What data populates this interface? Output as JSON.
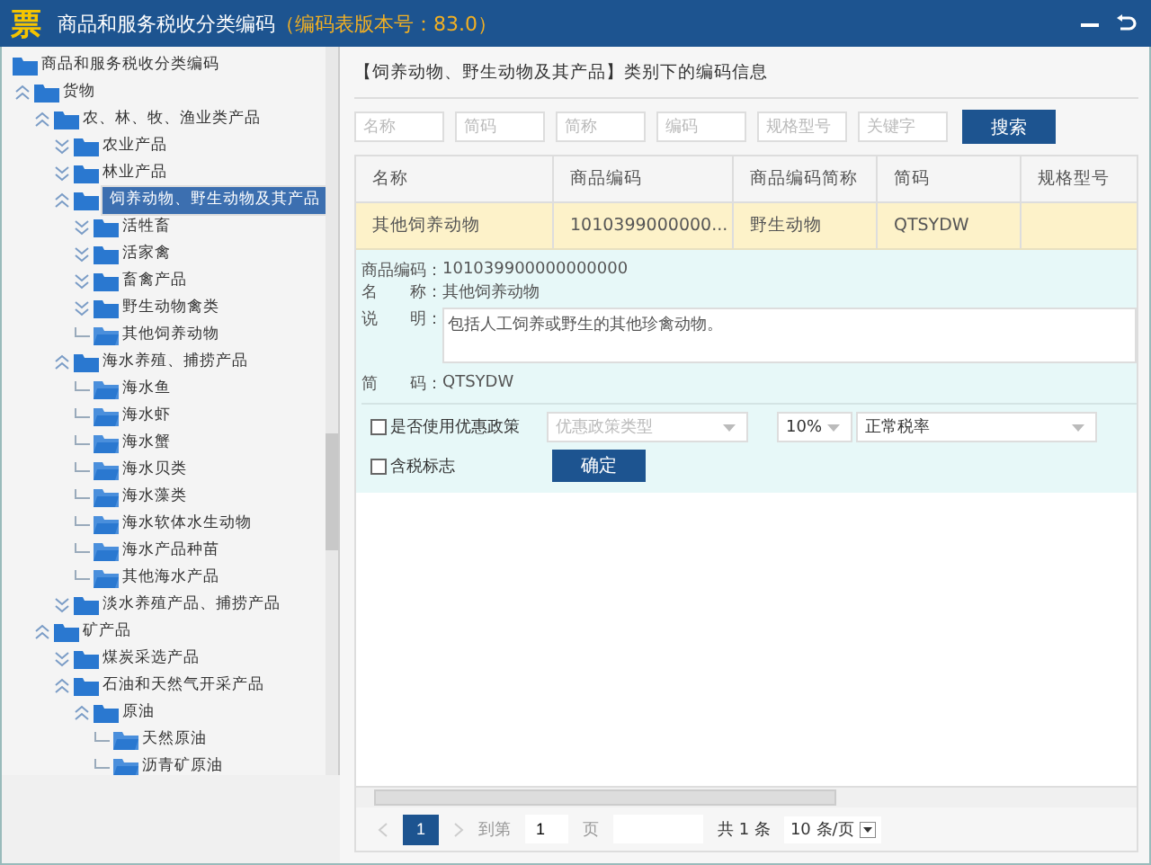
{
  "window": {
    "logo": "票",
    "title": "商品和服务税收分类编码",
    "version": "（编码表版本号：83.0）"
  },
  "tree": {
    "label": "商品和服务税收分类编码",
    "children": [
      {
        "label": "货物",
        "kind": "branch",
        "expanded": true,
        "selected": false,
        "children": [
          {
            "label": "农、林、牧、渔业类产品",
            "kind": "branch",
            "expanded": true,
            "selected": false,
            "children": [
              {
                "label": "农业产品",
                "kind": "branch",
                "expanded": false,
                "selected": false
              },
              {
                "label": "林业产品",
                "kind": "branch",
                "expanded": false,
                "selected": false
              },
              {
                "label": "饲养动物、野生动物及其产品",
                "kind": "branch",
                "expanded": true,
                "selected": true,
                "children": [
                  {
                    "label": "活牲畜",
                    "kind": "branch",
                    "expanded": false,
                    "selected": false
                  },
                  {
                    "label": "活家禽",
                    "kind": "branch",
                    "expanded": false,
                    "selected": false
                  },
                  {
                    "label": "畜禽产品",
                    "kind": "branch",
                    "expanded": false,
                    "selected": false
                  },
                  {
                    "label": "野生动物禽类",
                    "kind": "branch",
                    "expanded": false,
                    "selected": false
                  },
                  {
                    "label": "其他饲养动物",
                    "kind": "leaf",
                    "selected": false
                  }
                ]
              },
              {
                "label": "海水养殖、捕捞产品",
                "kind": "branch",
                "expanded": true,
                "selected": false,
                "children": [
                  {
                    "label": "海水鱼",
                    "kind": "leaf",
                    "selected": false
                  },
                  {
                    "label": "海水虾",
                    "kind": "leaf",
                    "selected": false
                  },
                  {
                    "label": "海水蟹",
                    "kind": "leaf",
                    "selected": false
                  },
                  {
                    "label": "海水贝类",
                    "kind": "leaf",
                    "selected": false
                  },
                  {
                    "label": "海水藻类",
                    "kind": "leaf",
                    "selected": false
                  },
                  {
                    "label": "海水软体水生动物",
                    "kind": "leaf",
                    "selected": false
                  },
                  {
                    "label": "海水产品种苗",
                    "kind": "leaf",
                    "selected": false
                  },
                  {
                    "label": "其他海水产品",
                    "kind": "leaf",
                    "selected": false
                  }
                ]
              },
              {
                "label": "淡水养殖产品、捕捞产品",
                "kind": "branch",
                "expanded": false,
                "selected": false
              }
            ]
          },
          {
            "label": "矿产品",
            "kind": "branch",
            "expanded": true,
            "selected": false,
            "children": [
              {
                "label": "煤炭采选产品",
                "kind": "branch",
                "expanded": false,
                "selected": false
              },
              {
                "label": "石油和天然气开采产品",
                "kind": "branch",
                "expanded": true,
                "selected": false,
                "children": [
                  {
                    "label": "原油",
                    "kind": "branch",
                    "expanded": true,
                    "selected": false,
                    "children": [
                      {
                        "label": "天然原油",
                        "kind": "leaf",
                        "selected": false
                      },
                      {
                        "label": "沥青矿原油",
                        "kind": "leaf",
                        "selected": false
                      }
                    ]
                  }
                ]
              }
            ]
          }
        ]
      }
    ]
  },
  "panel": {
    "heading": "【饲养动物、野生动物及其产品】类别下的编码信息",
    "filters": [
      {
        "placeholder": "名称"
      },
      {
        "placeholder": "简码"
      },
      {
        "placeholder": "简称"
      },
      {
        "placeholder": "编码"
      },
      {
        "placeholder": "规格型号"
      },
      {
        "placeholder": "关键字"
      }
    ],
    "search_button": "搜索",
    "table": {
      "columns": [
        "名称",
        "商品编码",
        "商品编码简称",
        "简码",
        "规格型号"
      ],
      "rows": [
        {
          "selected": true,
          "cells": [
            "其他饲养动物",
            "1010399000000...",
            "野生动物",
            "QTSYDW",
            ""
          ]
        }
      ]
    },
    "detail": {
      "code_label": "商品编码：",
      "code": "101039900000000000",
      "name_label": "名　　称：",
      "name": "其他饲养动物",
      "desc_label": "说　　明：",
      "desc": "包括人工饲养或野生的其他珍禽动物。",
      "short_label": "简　　码：",
      "short": "QTSYDW",
      "preferential": {
        "label": "是否使用优惠政策",
        "checked": false,
        "placeholder": "优惠政策类型"
      },
      "rate": "10%",
      "rate_type": "正常税率",
      "tax_included": {
        "label": "含税标志",
        "checked": false
      },
      "confirm": "确定"
    },
    "pager": {
      "current": "1",
      "goto_label": "到第",
      "goto_value": "1",
      "page_label": "页",
      "total": "共 1 条",
      "page_size": "10 条/页"
    }
  }
}
